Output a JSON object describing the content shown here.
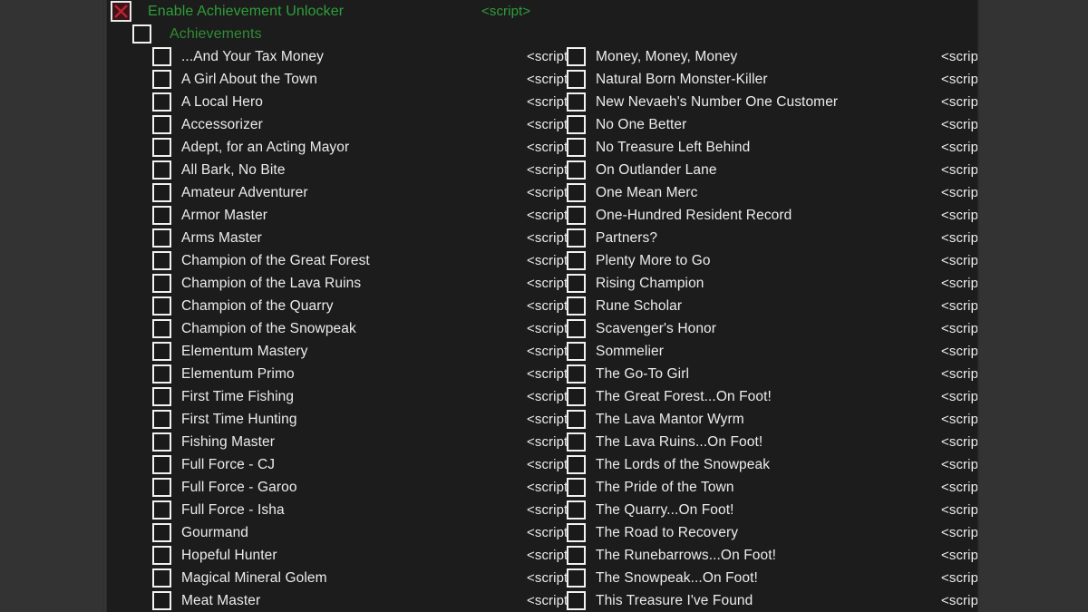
{
  "window": {
    "background_color": "#2e2e2e",
    "list_background_color": "#1c1c1c",
    "accent_green": "#2f9e3a",
    "checked_red": "#c02030"
  },
  "script_label": "<script>",
  "header": {
    "enable": {
      "label": "Enable Achievement Unlocker",
      "script": "<script>",
      "checkbox_state": "checked-x",
      "color": "#2f9e3a"
    },
    "group": {
      "label": "Achievements",
      "checkbox_state": "unchecked",
      "color": "#2f8c35"
    }
  },
  "columns": {
    "left": [
      {
        "label": "...And Your Tax Money",
        "script": "<script>",
        "checked": false
      },
      {
        "label": "A Girl About the Town",
        "script": "<script>",
        "checked": false
      },
      {
        "label": "A Local Hero",
        "script": "<script>",
        "checked": false
      },
      {
        "label": "Accessorizer",
        "script": "<script>",
        "checked": false
      },
      {
        "label": "Adept, for an Acting Mayor",
        "script": "<script>",
        "checked": false
      },
      {
        "label": "All Bark, No Bite",
        "script": "<script>",
        "checked": false
      },
      {
        "label": "Amateur Adventurer",
        "script": "<script>",
        "checked": false
      },
      {
        "label": "Armor Master",
        "script": "<script>",
        "checked": false
      },
      {
        "label": "Arms Master",
        "script": "<script>",
        "checked": false
      },
      {
        "label": "Champion of the Great Forest",
        "script": "<script>",
        "checked": false
      },
      {
        "label": "Champion of the Lava Ruins",
        "script": "<script>",
        "checked": false
      },
      {
        "label": "Champion of the Quarry",
        "script": "<script>",
        "checked": false
      },
      {
        "label": "Champion of the Snowpeak",
        "script": "<script>",
        "checked": false
      },
      {
        "label": "Elementum Mastery",
        "script": "<script>",
        "checked": false
      },
      {
        "label": "Elementum Primo",
        "script": "<script>",
        "checked": false
      },
      {
        "label": "First Time Fishing",
        "script": "<script>",
        "checked": false
      },
      {
        "label": "First Time Hunting",
        "script": "<script>",
        "checked": false
      },
      {
        "label": "Fishing Master",
        "script": "<script>",
        "checked": false
      },
      {
        "label": "Full Force - CJ",
        "script": "<script>",
        "checked": false
      },
      {
        "label": "Full Force - Garoo",
        "script": "<script>",
        "checked": false
      },
      {
        "label": "Full Force - Isha",
        "script": "<script>",
        "checked": false
      },
      {
        "label": "Gourmand",
        "script": "<script>",
        "checked": false
      },
      {
        "label": "Hopeful Hunter",
        "script": "<script>",
        "checked": false
      },
      {
        "label": "Magical Mineral Golem",
        "script": "<script>",
        "checked": false
      },
      {
        "label": "Meat Master",
        "script": "<script>",
        "checked": false
      }
    ],
    "right": [
      {
        "label": "Money, Money, Money",
        "script": "<script>",
        "checked": false
      },
      {
        "label": "Natural Born Monster-Killer",
        "script": "<script>",
        "checked": false
      },
      {
        "label": "New Nevaeh's Number One Customer",
        "script": "<script>",
        "checked": false
      },
      {
        "label": "No One Better",
        "script": "<script>",
        "checked": false
      },
      {
        "label": "No Treasure Left Behind",
        "script": "<script>",
        "checked": false
      },
      {
        "label": "On Outlander Lane",
        "script": "<script>",
        "checked": false
      },
      {
        "label": "One Mean Merc",
        "script": "<script>",
        "checked": false
      },
      {
        "label": "One-Hundred Resident Record",
        "script": "<script>",
        "checked": false
      },
      {
        "label": "Partners?",
        "script": "<script>",
        "checked": false
      },
      {
        "label": "Plenty More to Go",
        "script": "<script>",
        "checked": false
      },
      {
        "label": "Rising Champion",
        "script": "<script>",
        "checked": false
      },
      {
        "label": "Rune Scholar",
        "script": "<script>",
        "checked": false
      },
      {
        "label": "Scavenger's Honor",
        "script": "<script>",
        "checked": false
      },
      {
        "label": "Sommelier",
        "script": "<script>",
        "checked": false
      },
      {
        "label": "The Go-To Girl",
        "script": "<script>",
        "checked": false
      },
      {
        "label": "The Great Forest...On Foot!",
        "script": "<script>",
        "checked": false
      },
      {
        "label": "The Lava Mantor Wyrm",
        "script": "<script>",
        "checked": false
      },
      {
        "label": "The Lava Ruins...On Foot!",
        "script": "<script>",
        "checked": false
      },
      {
        "label": "The Lords of the Snowpeak",
        "script": "<script>",
        "checked": false
      },
      {
        "label": "The Pride of the Town",
        "script": "<script>",
        "checked": false
      },
      {
        "label": "The Quarry...On Foot!",
        "script": "<script>",
        "checked": false
      },
      {
        "label": "The Road to Recovery",
        "script": "<script>",
        "checked": false
      },
      {
        "label": "The Runebarrows...On Foot!",
        "script": "<script>",
        "checked": false
      },
      {
        "label": "The Snowpeak...On Foot!",
        "script": "<script>",
        "checked": false
      },
      {
        "label": "This Treasure I've Found",
        "script": "<script>",
        "checked": false
      }
    ]
  }
}
